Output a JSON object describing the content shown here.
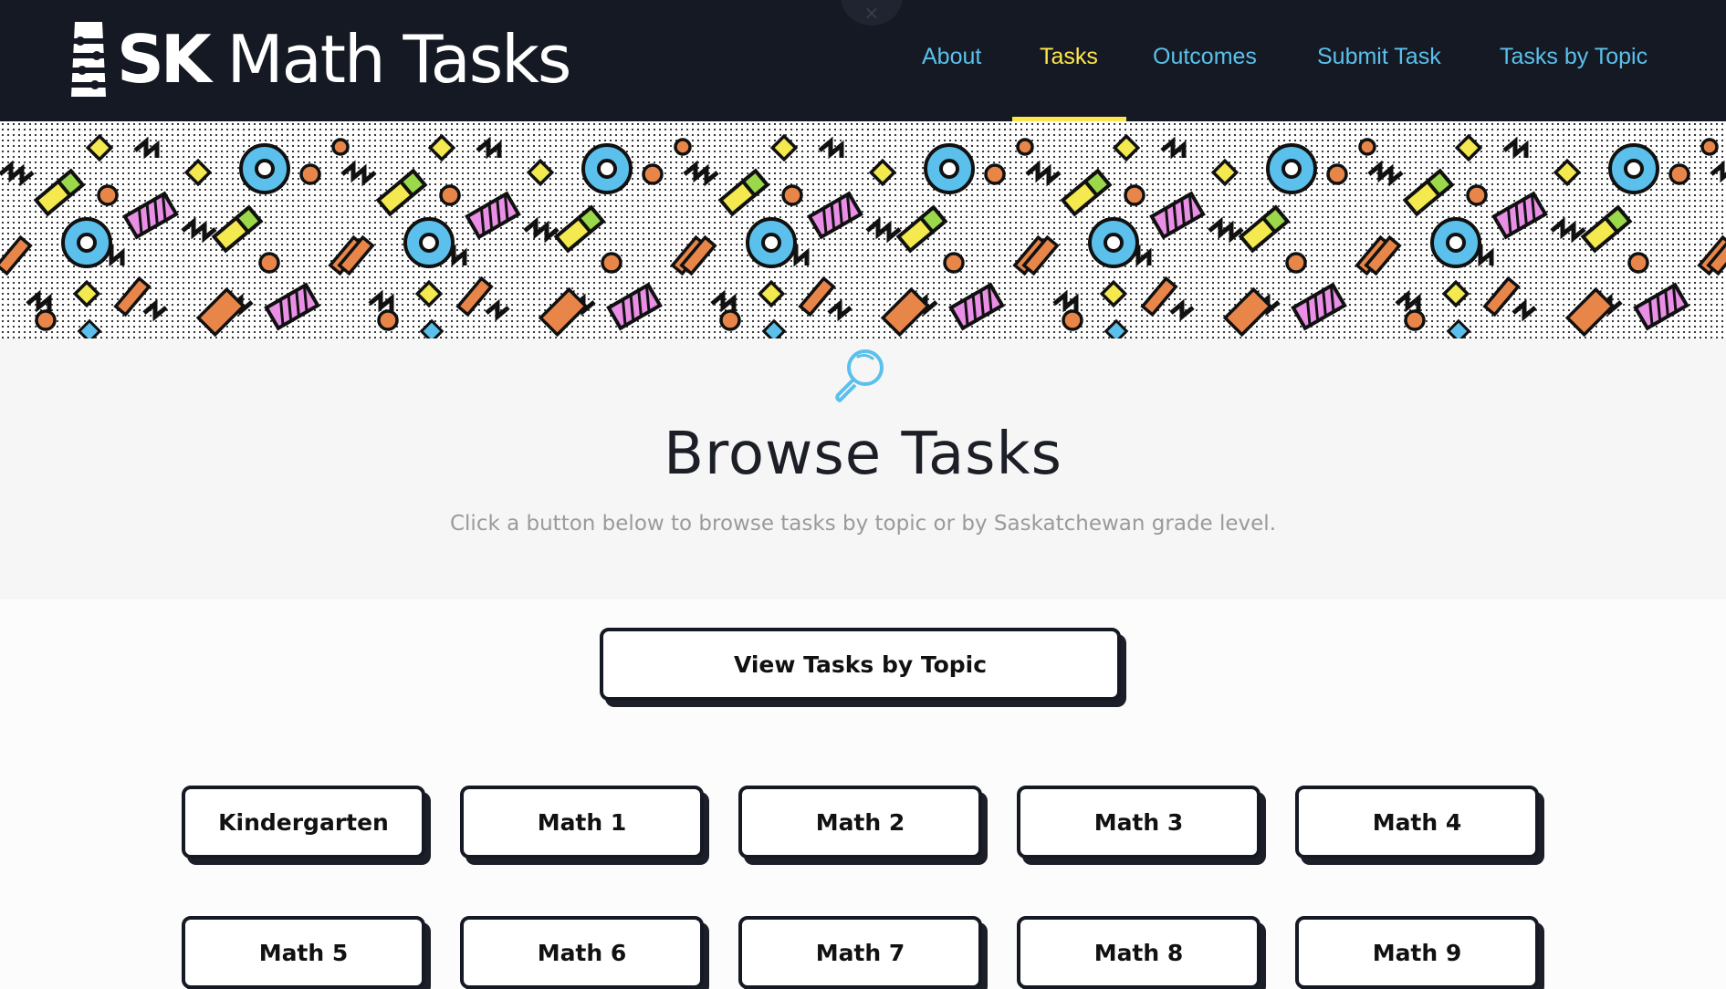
{
  "header": {
    "logo_bold": "SK",
    "logo_text": "Math Tasks",
    "top_tab_glyph": "×",
    "nav": [
      {
        "label": "About",
        "active": false
      },
      {
        "label": "Tasks",
        "active": true
      },
      {
        "label": "Outcomes",
        "active": false
      },
      {
        "label": "Submit Task",
        "active": false
      },
      {
        "label": "Tasks by Topic",
        "active": false
      }
    ]
  },
  "intro": {
    "icon": "magnifying-glass-icon",
    "title": "Browse Tasks",
    "subtitle": "Click a button below to browse tasks by topic or by Saskatchewan grade level."
  },
  "topic_button": {
    "label": "View Tasks by Topic"
  },
  "grade_buttons": [
    {
      "label": "Kindergarten"
    },
    {
      "label": "Math 1"
    },
    {
      "label": "Math 2"
    },
    {
      "label": "Math 3"
    },
    {
      "label": "Math 4"
    },
    {
      "label": "Math 5"
    },
    {
      "label": "Math 6"
    },
    {
      "label": "Math 7"
    },
    {
      "label": "Math 8"
    },
    {
      "label": "Math 9"
    }
  ],
  "colors": {
    "header_bg": "#151923",
    "nav_link": "#5bc0eb",
    "nav_active": "#fde74c",
    "pattern_blue": "#5bc0eb",
    "pattern_orange": "#e8864a",
    "pattern_yellow": "#f4e94e",
    "pattern_green": "#9bd94a",
    "pattern_pink": "#e98fe6"
  }
}
